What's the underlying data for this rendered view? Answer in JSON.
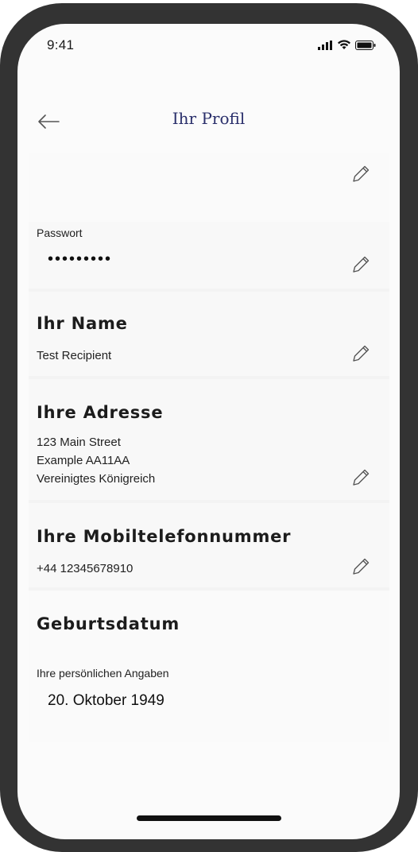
{
  "status_bar": {
    "time": "9:41",
    "icons": [
      "signal-icon",
      "wifi-icon",
      "battery-icon"
    ]
  },
  "nav": {
    "back_icon": "arrow-left-icon",
    "title": "Ihr Profil"
  },
  "email": {
    "value": "",
    "edit_icon": "pencil-icon"
  },
  "password": {
    "label": "Passwort",
    "value": "•••••••••",
    "edit_icon": "pencil-icon"
  },
  "name": {
    "heading": "Ihr Name",
    "value": "Test Recipient",
    "edit_icon": "pencil-icon"
  },
  "address": {
    "heading": "Ihre Adresse",
    "lines": [
      "123 Main Street",
      "Example AA11AA",
      "Vereinigtes Königreich"
    ],
    "edit_icon": "pencil-icon"
  },
  "mobile": {
    "heading": "Ihre Mobiltelefonnummer",
    "value": "+44 12345678910",
    "edit_icon": "pencil-icon"
  },
  "dob": {
    "heading": "Geburtsdatum",
    "label": "Ihre persönlichen Angaben",
    "value": "20. Oktober 1949"
  },
  "colors": {
    "title": "#2a2f6b",
    "frame": "#333333",
    "background": "#fbfbfb"
  }
}
